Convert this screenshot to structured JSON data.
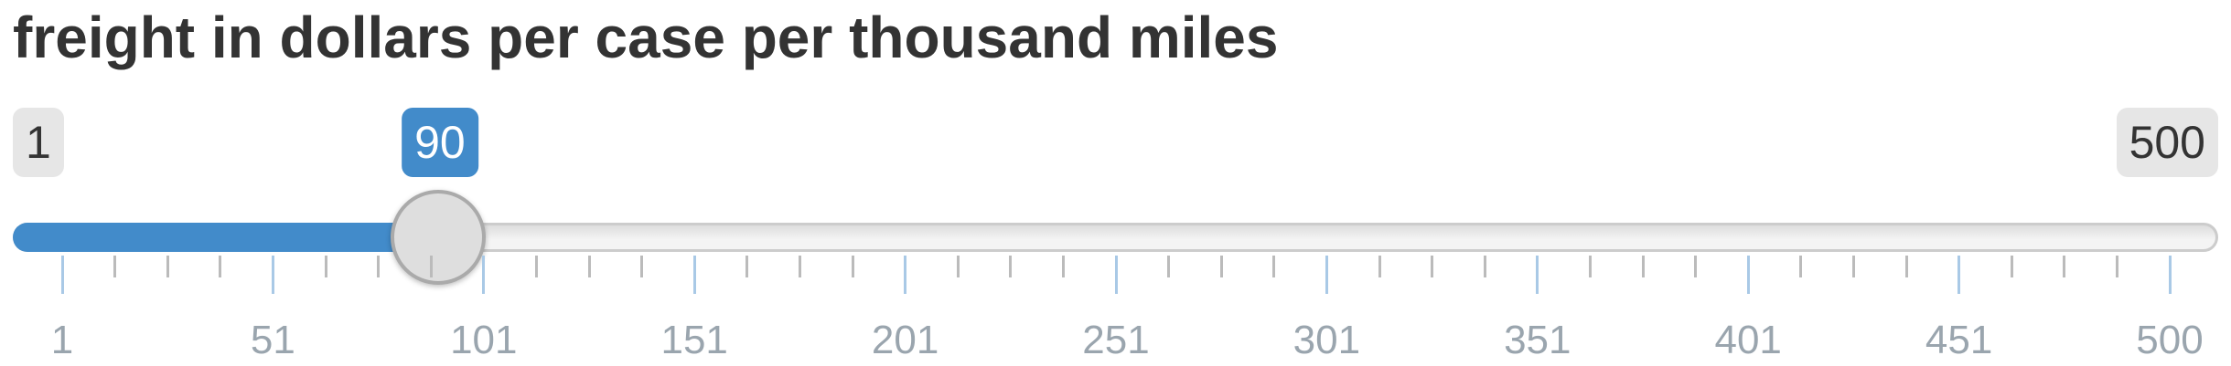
{
  "slider": {
    "label": "freight in dollars per case per thousand miles",
    "min": 1,
    "max": 500,
    "value": 90,
    "min_label": "1",
    "max_label": "500",
    "value_label": "90",
    "tick_labels": [
      "1",
      "51",
      "101",
      "151",
      "201",
      "251",
      "301",
      "351",
      "401",
      "451",
      "500"
    ],
    "colors": {
      "accent": "#428bca",
      "text": "#333333",
      "tick_label": "#9aa5ae",
      "badge_bg": "#e6e6e6",
      "handle": "#dedede"
    }
  }
}
